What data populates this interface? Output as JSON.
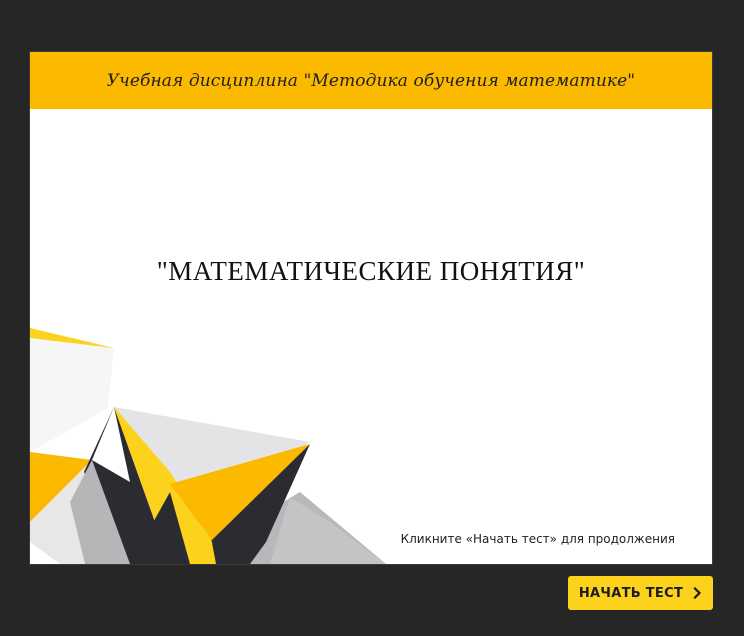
{
  "slide": {
    "header_text": "Учебная дисциплина \"Методика обучения математике\"",
    "title": "\"МАТЕМАТИЧЕСКИЕ ПОНЯТИЯ\"",
    "hint": "Кликните «Начать тест» для продолжения"
  },
  "controls": {
    "start_button_label": "НАЧАТЬ ТЕСТ",
    "start_button_icon": "chevron-right-icon"
  },
  "colors": {
    "background": "#262626",
    "accent_yellow": "#fbb900",
    "button_yellow": "#fcd21c",
    "dark_shape": "#2b2c31",
    "light_gray": "#e6e6e8",
    "mid_gray": "#b9b9bc"
  }
}
